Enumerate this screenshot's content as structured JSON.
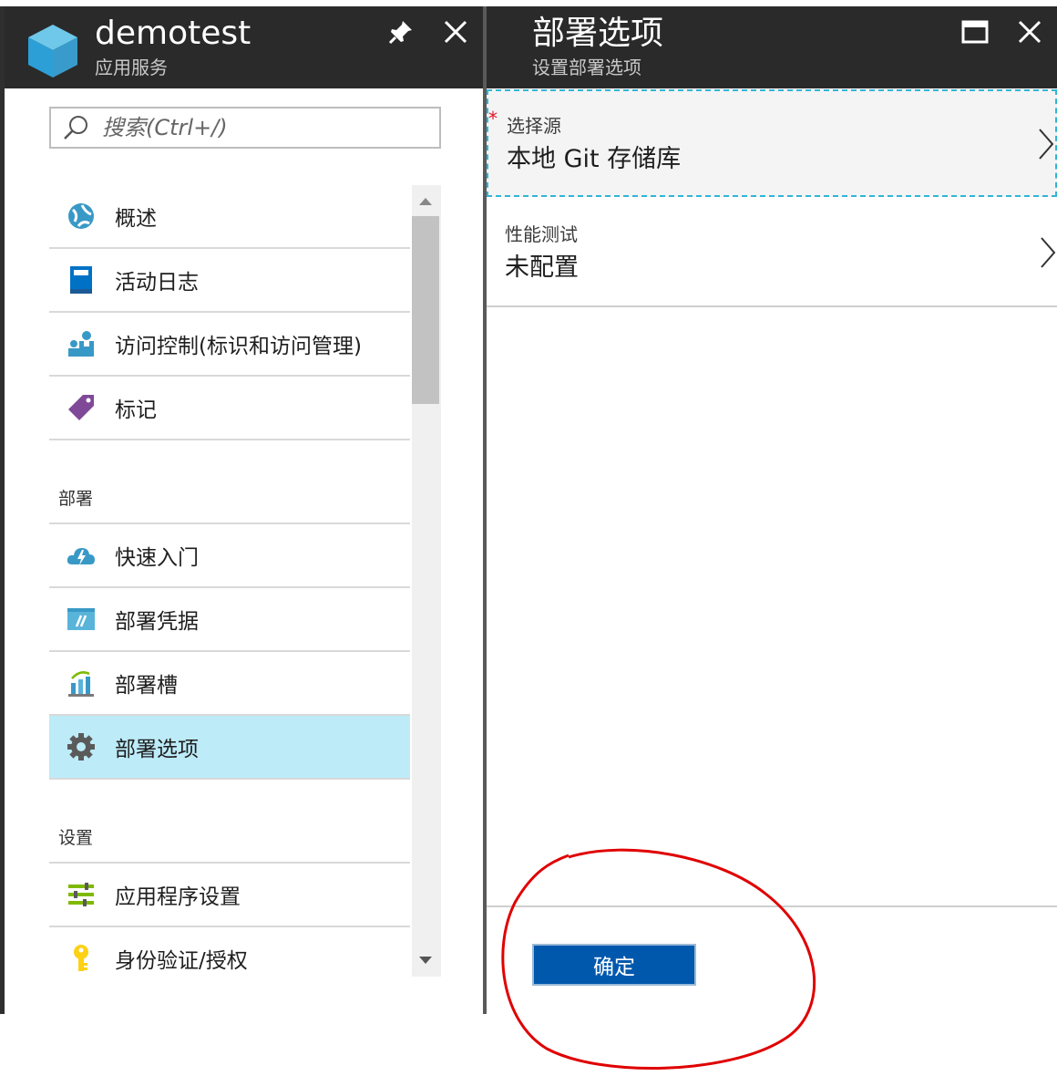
{
  "left_blade": {
    "title": "demotest",
    "subtitle": "应用服务",
    "search_placeholder": "搜索(Ctrl+/)",
    "menu_items": [
      {
        "label": "概述",
        "icon": "globe-icon"
      },
      {
        "label": "活动日志",
        "icon": "log-book-icon"
      },
      {
        "label": "访问控制(标识和访问管理)",
        "icon": "people-icon"
      },
      {
        "label": "标记",
        "icon": "tag-icon"
      }
    ],
    "sections": [
      {
        "label": "部署",
        "items": [
          {
            "label": "快速入门",
            "icon": "cloud-bolt-icon"
          },
          {
            "label": "部署凭据",
            "icon": "credentials-icon"
          },
          {
            "label": "部署槽",
            "icon": "slots-icon"
          },
          {
            "label": "部署选项",
            "icon": "gear-icon",
            "selected": true
          }
        ]
      },
      {
        "label": "设置",
        "items": [
          {
            "label": "应用程序设置",
            "icon": "app-settings-icon"
          },
          {
            "label": "身份验证/授权",
            "icon": "key-icon"
          }
        ]
      }
    ]
  },
  "right_blade": {
    "title": "部署选项",
    "subtitle": "设置部署选项",
    "options": [
      {
        "label": "选择源",
        "value": "本地 Git 存储库",
        "required": true
      },
      {
        "label": "性能测试",
        "value": "未配置",
        "required": false
      }
    ],
    "required_mark": "*",
    "ok_label": "确定"
  },
  "colors": {
    "header_bg": "#2a2a2a",
    "selected_bg": "#bdebf8",
    "primary_button": "#0058ad",
    "focus_border": "#30b6d6",
    "annotation": "#e00000"
  }
}
